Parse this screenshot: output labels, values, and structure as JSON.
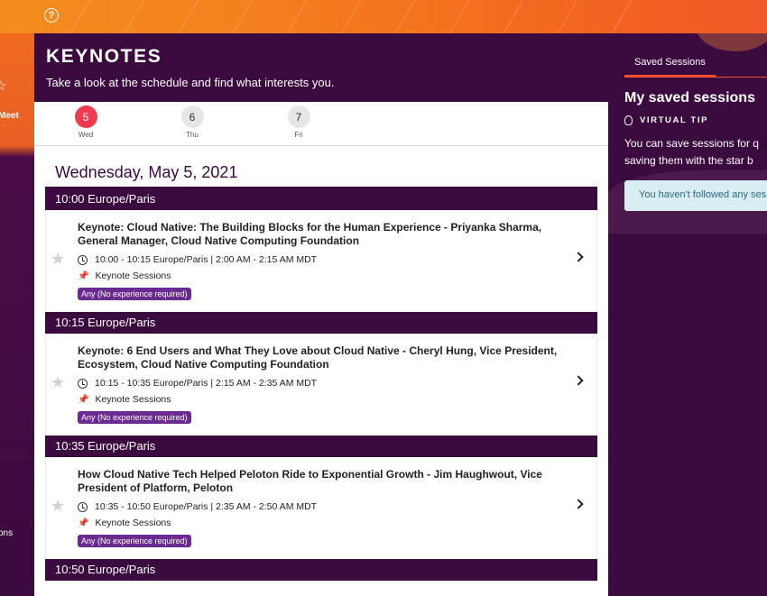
{
  "header": {
    "title": "KEYNOTES",
    "subtitle": "Take a look at the schedule and find what interests you."
  },
  "left_nav": {
    "meet_label": "Meet",
    "ons_label": "ons"
  },
  "days": [
    {
      "num": "5",
      "label": "Wed",
      "active": true
    },
    {
      "num": "6",
      "label": "Thu",
      "active": false
    },
    {
      "num": "7",
      "label": "Fri",
      "active": false
    }
  ],
  "date_heading": "Wednesday, May 5, 2021",
  "slots": [
    {
      "time": "10:00 Europe/Paris",
      "session": {
        "title": "Keynote: Cloud Native: The Building Blocks for the Human Experience - Priyanka Sharma, General Manager, Cloud Native Computing Foundation",
        "time": "10:00 - 10:15 Europe/Paris | 2:00 AM - 2:15 AM MDT",
        "track": "Keynote Sessions",
        "badge": "Any (No experience required)"
      }
    },
    {
      "time": "10:15 Europe/Paris",
      "session": {
        "title": "Keynote: 6 End Users and What They Love about Cloud Native - Cheryl Hung, Vice President, Ecosystem, Cloud Native Computing Foundation",
        "time": "10:15 - 10:35 Europe/Paris | 2:15 AM - 2:35 AM MDT",
        "track": "Keynote Sessions",
        "badge": "Any (No experience required)"
      }
    },
    {
      "time": "10:35 Europe/Paris",
      "session": {
        "title": "How Cloud Native Tech Helped Peloton Ride to Exponential Growth - Jim Haughwout, Vice President of Platform, Peloton",
        "time": "10:35 - 10:50 Europe/Paris | 2:35 AM - 2:50 AM MDT",
        "track": "Keynote Sessions",
        "badge": "Any (No experience required)"
      }
    },
    {
      "time": "10:50 Europe/Paris"
    }
  ],
  "right_panel": {
    "tab_label": "Saved Sessions",
    "heading": "My saved sessions",
    "tip_label": "VIRTUAL TIP",
    "tip_line1": "You can save sessions for q",
    "tip_line2": "saving them with the star b",
    "notice": "You haven't followed any ses"
  },
  "colors": {
    "brand_purple": "#3b0a3e",
    "active_day": "#f03a4f",
    "badge_purple": "#6b2a8f",
    "accent_orange": "#f0512f"
  }
}
